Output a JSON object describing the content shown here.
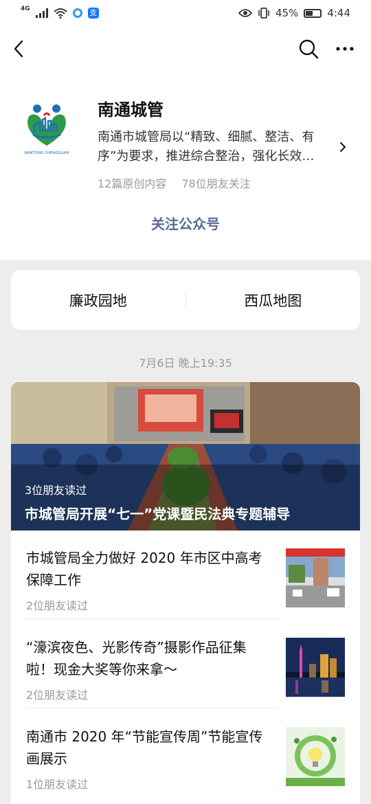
{
  "status_bar": {
    "network": "4G",
    "battery": "45%",
    "time": "4:44"
  },
  "nav": {
    "back_icon": "chevron-left-icon",
    "search_icon": "search-icon",
    "more_icon": "more-icon"
  },
  "account": {
    "logo_text": "NANTONG CHENGGUAN",
    "name": "南通城管",
    "description": "南通市城管局以“精致、细腻、整洁、有序”为要求，推进综合整治，强化长效…",
    "original_count": "12篇原创内容",
    "friends_follow": "78位朋友关注",
    "follow_label": "关注公众号"
  },
  "menu": {
    "items": [
      {
        "label": "廉政园地"
      },
      {
        "label": "西瓜地图"
      }
    ]
  },
  "feed": {
    "date": "7月6日 晚上19:35",
    "cover": {
      "reads": "3位朋友读过",
      "title": "市城管局开展“七一”党课暨民法典专题辅导"
    },
    "articles": [
      {
        "title": "市城管局全力做好 2020 年市区中高考保障工作",
        "reads": "2位朋友读过"
      },
      {
        "title": "“濠滨夜色、光影传奇”摄影作品征集啦！现金大奖等你来拿～",
        "reads": "2位朋友读过"
      },
      {
        "title": "南通市 2020 年“节能宣传周”节能宣传画展示",
        "reads": "1位朋友读过"
      }
    ]
  },
  "colors": {
    "link_blue": "#576b95",
    "background": "#ededed",
    "logo_blue": "#1f6fb8",
    "logo_green": "#2e9a47",
    "logo_red": "#d9262c"
  }
}
